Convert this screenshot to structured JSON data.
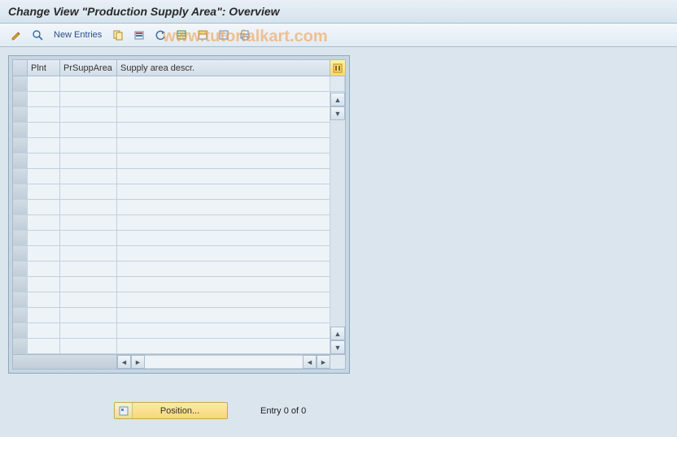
{
  "header": {
    "title": "Change View \"Production Supply Area\": Overview"
  },
  "toolbar": {
    "new_entries": "New Entries"
  },
  "table": {
    "columns": {
      "plnt": "Plnt",
      "prsupparea": "PrSuppArea",
      "descr": "Supply area descr."
    },
    "row_count": 18
  },
  "footer": {
    "position_label": "Position...",
    "entry_text": "Entry 0 of 0"
  },
  "watermark": "www.tutorialkart.com"
}
